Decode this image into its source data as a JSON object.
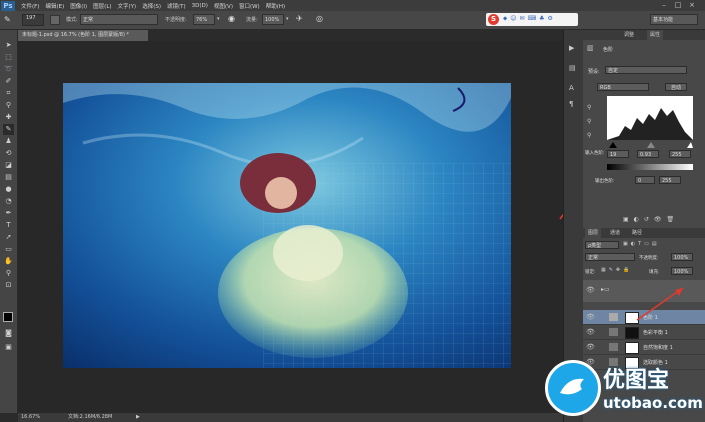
{
  "app": {
    "logo": "Ps"
  },
  "menu": [
    "文件(F)",
    "编辑(E)",
    "图像(I)",
    "图层(L)",
    "文字(Y)",
    "选择(S)",
    "滤镜(T)",
    "3D(D)",
    "视图(V)",
    "窗口(W)",
    "帮助(H)"
  ],
  "options": {
    "mode_label": "模式:",
    "mode_value": "正常",
    "opacity_label": "不透明度:",
    "opacity_value": "76%",
    "flow_label": "流量:",
    "flow_value": "100%",
    "brush_size": "197",
    "workspace": "基本功能"
  },
  "document": {
    "tab_title": "未标题-1.psd @ 16.7% (色阶 1, 图层蒙版/8) *",
    "zoom": "16.67%",
    "doc_info": "文档:2.16M/6.28M"
  },
  "properties": {
    "tabs": [
      "调整",
      "属性"
    ],
    "title": "色阶",
    "preset_label": "预设:",
    "preset_value": "自定",
    "channel_value": "RGB",
    "auto_button": "自动",
    "input_label": "输入色阶:",
    "input_black": "19",
    "input_mid": "0.93",
    "input_white": "255",
    "output_label": "输出色阶:",
    "output_black": "0",
    "output_white": "255"
  },
  "layers": {
    "tabs": [
      "图层",
      "通道",
      "路径"
    ],
    "kind_label": "ρ类型",
    "blend_mode": "正常",
    "opacity_label": "不透明度:",
    "opacity_value": "100%",
    "lock_label": "锁定:",
    "fill_label": "填充:",
    "fill_value": "100%",
    "items": [
      {
        "name": "色阶 1"
      },
      {
        "name": "色彩平衡 1"
      },
      {
        "name": "自然饱和度 1"
      },
      {
        "name": "选取颜色 1"
      }
    ]
  },
  "watermark": {
    "brand": "优图宝",
    "domain": "utobao.com"
  }
}
